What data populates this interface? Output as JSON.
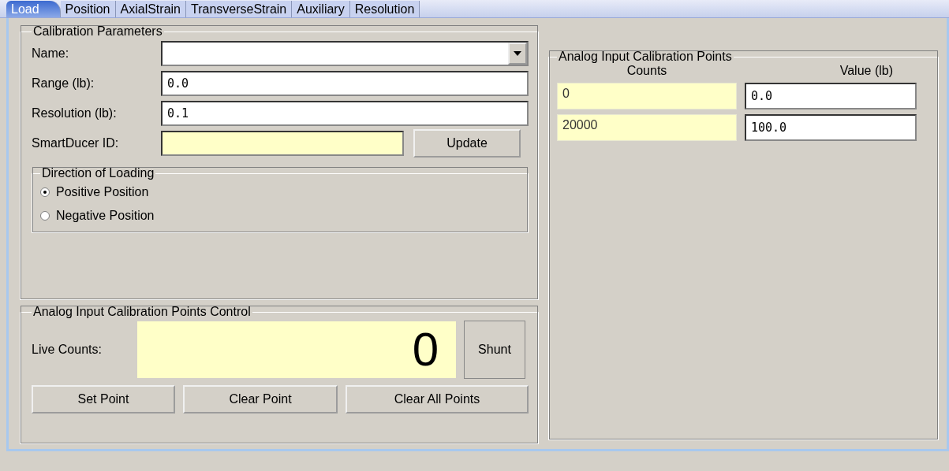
{
  "tabs": [
    {
      "label": "Load",
      "selected": true
    },
    {
      "label": "Position",
      "selected": false
    },
    {
      "label": "AxialStrain",
      "selected": false
    },
    {
      "label": "TransverseStrain",
      "selected": false
    },
    {
      "label": "Auxiliary",
      "selected": false
    },
    {
      "label": "Resolution",
      "selected": false
    }
  ],
  "calibration_parameters": {
    "title": "Calibration Parameters",
    "name": {
      "label": "Name:"
    },
    "range": {
      "label": "Range  (lb):",
      "value": "0.0"
    },
    "resolution": {
      "label": "Resolution  (lb):",
      "value": "0.1"
    },
    "smartducer": {
      "label": "SmartDucer ID:",
      "button": "Update"
    },
    "direction": {
      "title": "Direction of Loading",
      "options": [
        {
          "label": "Positive Position",
          "selected": true
        },
        {
          "label": "Negative Position",
          "selected": false
        }
      ]
    }
  },
  "points_control": {
    "title": "Analog Input Calibration Points Control",
    "live_label": "Live Counts:",
    "live_value": "0",
    "shunt": "Shunt",
    "buttons": [
      "Set Point",
      "Clear Point",
      "Clear All Points"
    ]
  },
  "points": {
    "title": "Analog Input Calibration Points",
    "columns": [
      "Counts",
      "Value (lb)"
    ],
    "rows": [
      {
        "counts": "0",
        "value": "0.0"
      },
      {
        "counts": "20000",
        "value": "100.0"
      }
    ]
  }
}
